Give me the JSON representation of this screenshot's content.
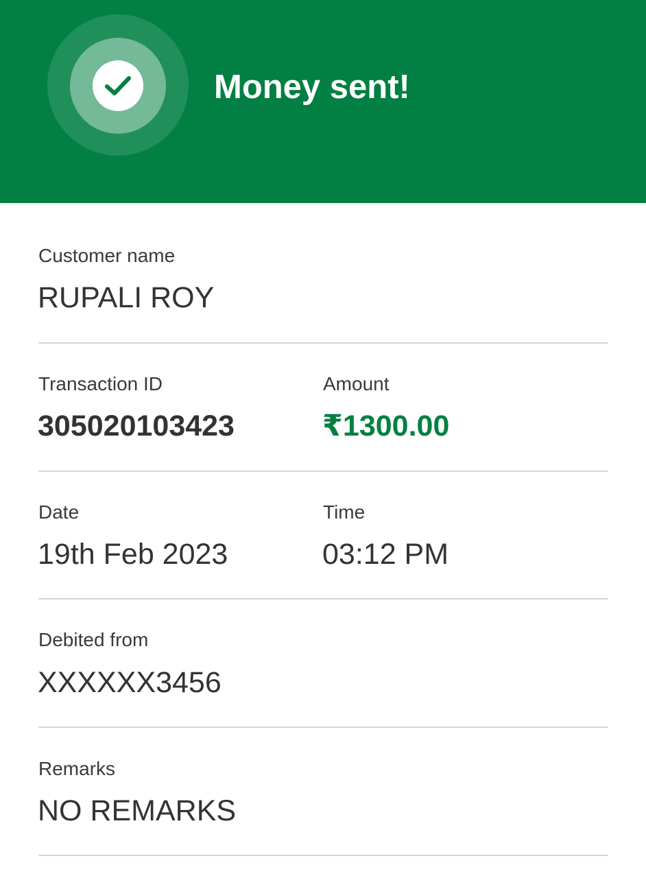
{
  "header": {
    "title": "Money sent!",
    "icon": "check-icon",
    "background_color": "#028043"
  },
  "details": {
    "customer_name": {
      "label": "Customer name",
      "value": "RUPALI ROY"
    },
    "transaction_id": {
      "label": "Transaction ID",
      "value": "305020103423"
    },
    "amount": {
      "label": "Amount",
      "value": "₹1300.00",
      "color": "#028043"
    },
    "date": {
      "label": "Date",
      "value": "19th Feb 2023"
    },
    "time": {
      "label": "Time",
      "value": "03:12 PM"
    },
    "debited_from": {
      "label": "Debited from",
      "value": "XXXXXX3456"
    },
    "remarks": {
      "label": "Remarks",
      "value": "NO REMARKS"
    }
  }
}
